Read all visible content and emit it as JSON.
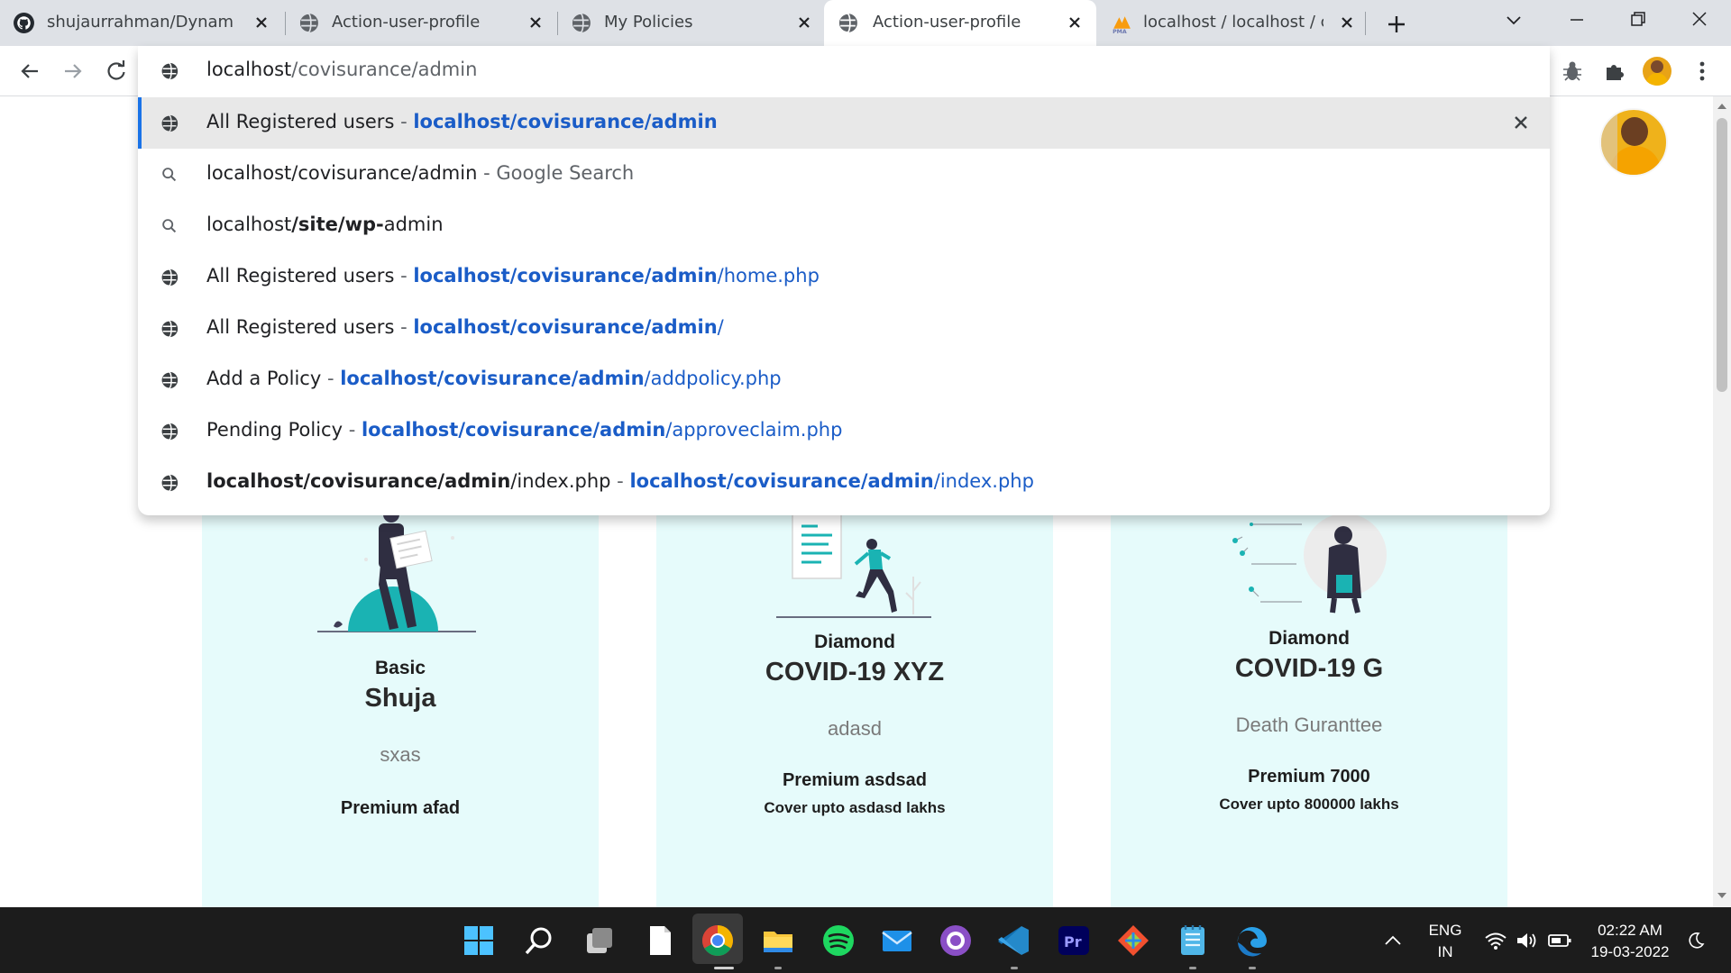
{
  "browser": {
    "tabs": [
      {
        "title": "shujaurrahman/Dynamic-Insurance-Management-System",
        "favicon": "github-icon"
      },
      {
        "title": "Action-user-profile",
        "favicon": "globe-icon"
      },
      {
        "title": "My Policies",
        "favicon": "globe-icon"
      },
      {
        "title": "Action-user-profile",
        "favicon": "globe-icon",
        "active": true
      },
      {
        "title": "localhost / localhost / covisurance",
        "favicon": "phpmyadmin-icon"
      }
    ],
    "address": {
      "host": "localhost",
      "path": "/covisurance/admin"
    },
    "suggestions": [
      {
        "title": "All Registered users",
        "sep": " - ",
        "url_bold": "localhost/covisurance/admin",
        "url_rest": "",
        "icon": "globe-icon",
        "selected": true
      },
      {
        "plain": "localhost/covisurance/admin",
        "sep": " - ",
        "source": "Google Search",
        "icon": "search-icon"
      },
      {
        "q_a": "localhost",
        "q_b": "/site/wp-",
        "q_c": "admin",
        "icon": "search-icon"
      },
      {
        "title": "All Registered users",
        "sep": " - ",
        "url_bold": "localhost/covisurance/admin",
        "url_rest": "/home.php",
        "icon": "globe-icon"
      },
      {
        "title": "All Registered users",
        "sep": " - ",
        "url_bold": "localhost/covisurance/admin",
        "url_rest": "/",
        "icon": "globe-icon"
      },
      {
        "title": "Add a Policy",
        "sep": " - ",
        "url_bold": "localhost/covisurance/admin",
        "url_rest": "/addpolicy.php",
        "icon": "globe-icon"
      },
      {
        "title": "Pending Policy",
        "sep": " - ",
        "url_bold": "localhost/covisurance/admin",
        "url_rest": "/approveclaim.php",
        "icon": "globe-icon"
      },
      {
        "title_bold": "localhost/covisurance/admin",
        "title_rest": "/index.php",
        "sep": " - ",
        "url_bold": "localhost/covisurance/admin",
        "url_rest": "/index.php",
        "icon": "globe-icon"
      }
    ]
  },
  "cards": [
    {
      "plan": "Basic",
      "name": "Shuja",
      "desc": "sxas",
      "premium": "Premium afad",
      "cover": ""
    },
    {
      "plan": "Diamond",
      "name": "COVID-19 XYZ",
      "desc": "adasd",
      "premium": "Premium asdsad",
      "cover": "Cover upto asdasd lakhs"
    },
    {
      "plan": "Diamond",
      "name": "COVID-19 G",
      "desc": "Death Guranttee",
      "premium": "Premium 7000",
      "cover": "Cover upto 800000 lakhs"
    }
  ],
  "taskbar": {
    "apps": [
      "windows-start-icon",
      "search-icon",
      "task-view-icon",
      "notepad-file-icon",
      "chrome-icon",
      "file-explorer-icon",
      "spotify-icon",
      "mail-icon",
      "github-desktop-icon",
      "vscode-icon",
      "premiere-pro-icon",
      "git-icon",
      "notepad-icon",
      "edge-icon"
    ],
    "lang": "ENG",
    "region": "IN",
    "time": "02:22 AM",
    "date": "19-03-2022"
  },
  "colors": {
    "accent": "#1a73e8",
    "url": "#1a5cc7",
    "card_bg": "#e6fbfb",
    "teal": "#1ab3b3"
  }
}
